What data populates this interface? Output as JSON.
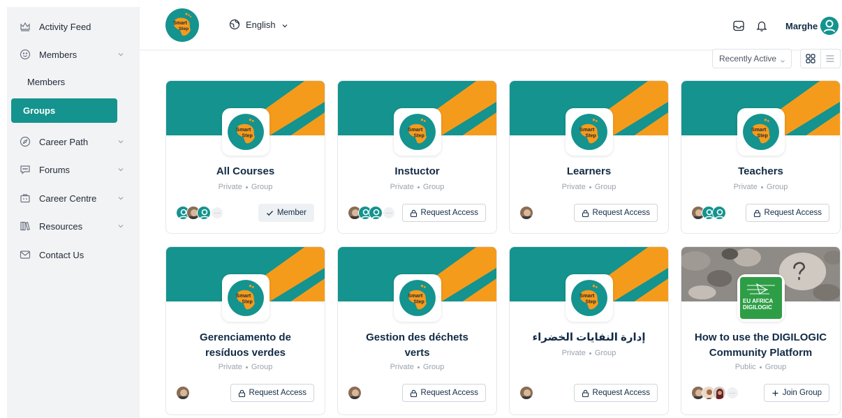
{
  "sidebar": {
    "items": [
      {
        "label": "Activity Feed",
        "icon": "crown-icon"
      },
      {
        "label": "Members",
        "icon": "smiley-icon",
        "expandable": true
      },
      {
        "label": "Members",
        "sub": true
      },
      {
        "label": "Groups",
        "active": true
      },
      {
        "label": "Career Path",
        "icon": "compass-icon",
        "expandable": true
      },
      {
        "label": "Forums",
        "icon": "chat-icon",
        "expandable": true
      },
      {
        "label": "Career Centre",
        "icon": "briefcase-icon",
        "expandable": true
      },
      {
        "label": "Resources",
        "icon": "books-icon",
        "expandable": true
      },
      {
        "label": "Contact Us",
        "icon": "envelope-icon"
      }
    ]
  },
  "header": {
    "logo_text_1": "Smart",
    "logo_text_2": "Step",
    "language": "English",
    "user_name": "Marghe"
  },
  "controls": {
    "sort_value": "Recently Active",
    "view_modes": [
      "grid-view",
      "list-view"
    ]
  },
  "colors": {
    "accent": "#14938f",
    "orange": "#f59b1c"
  },
  "groups": [
    {
      "title": "All Courses",
      "privacy": "Private",
      "type": "Group",
      "action": "Member",
      "action_icon": "check-icon"
    },
    {
      "title": "Instuctor",
      "privacy": "Private",
      "type": "Group",
      "action": "Request Access",
      "action_icon": "lock-icon"
    },
    {
      "title": "Learners",
      "privacy": "Private",
      "type": "Group",
      "action": "Request Access",
      "action_icon": "lock-icon"
    },
    {
      "title": "Teachers",
      "privacy": "Private",
      "type": "Group",
      "action": "Request Access",
      "action_icon": "lock-icon"
    },
    {
      "title_line1": "Gerenciamento de",
      "title_line2": "resíduos verdes",
      "privacy": "Private",
      "type": "Group",
      "action": "Request Access",
      "action_icon": "lock-icon"
    },
    {
      "title_line1": "Gestion des déchets",
      "title_line2": "verts",
      "privacy": "Private",
      "type": "Group",
      "action": "Request Access",
      "action_icon": "lock-icon"
    },
    {
      "title": "إدارة النفايات الخضراء",
      "privacy": "Private",
      "type": "Group",
      "action": "Request Access",
      "action_icon": "lock-icon"
    },
    {
      "title_line1": "How to use the DIGILOGIC",
      "title_line2": "Community Platform",
      "privacy": "Public",
      "type": "Group",
      "action": "Join Group",
      "action_icon": "plus-icon",
      "logo_line1": "EU",
      "logo_line2": "AFRICA",
      "logo_line3": "DIGILOGIC"
    }
  ]
}
